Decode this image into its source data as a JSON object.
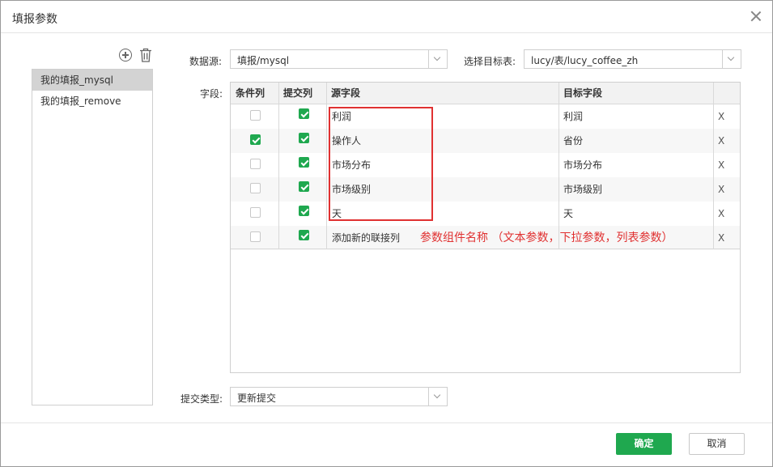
{
  "dialog": {
    "title": "填报参数"
  },
  "left_panel": {
    "items": [
      {
        "label": "我的填报_mysql",
        "selected": true
      },
      {
        "label": "我的填报_remove",
        "selected": false
      }
    ]
  },
  "form": {
    "datasource_label": "数据源:",
    "datasource_value": "填报/mysql",
    "target_table_label": "选择目标表:",
    "target_table_value": "lucy/表/lucy_coffee_zh",
    "fields_label": "字段:",
    "submit_type_label": "提交类型:",
    "submit_type_value": "更新提交"
  },
  "table": {
    "headers": [
      "条件列",
      "提交列",
      "源字段",
      "目标字段",
      ""
    ],
    "rows": [
      {
        "condition": false,
        "submit": true,
        "source": "利润",
        "target": "利润",
        "delete": "X"
      },
      {
        "condition": true,
        "submit": true,
        "source": "操作人",
        "target": "省份",
        "delete": "X"
      },
      {
        "condition": false,
        "submit": true,
        "source": "市场分布",
        "target": "市场分布",
        "delete": "X"
      },
      {
        "condition": false,
        "submit": true,
        "source": "市场级别",
        "target": "市场级别",
        "delete": "X"
      },
      {
        "condition": false,
        "submit": true,
        "source": "天",
        "target": "天",
        "delete": "X"
      },
      {
        "condition": false,
        "submit": true,
        "source": "添加新的联接列",
        "target": "",
        "delete": "X"
      }
    ]
  },
  "annotation": "参数组件名称 （文本参数，下拉参数，列表参数）",
  "footer": {
    "ok_label": "确定",
    "cancel_label": "取消"
  },
  "colors": {
    "accent": "#1fa84f",
    "annotation": "#e03131"
  }
}
